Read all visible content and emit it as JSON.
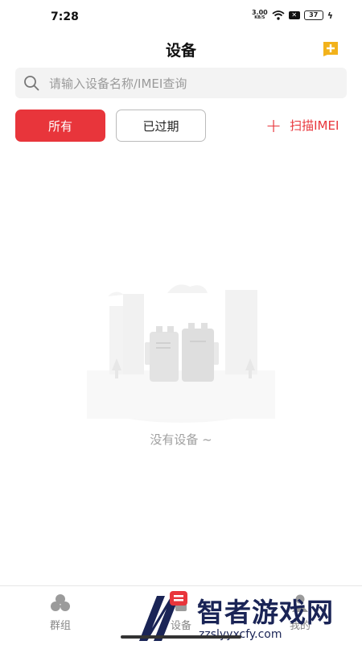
{
  "status_bar": {
    "time": "7:28",
    "speed_value": "3.00",
    "speed_unit": "KB/S",
    "battery": "37"
  },
  "header": {
    "title": "设备",
    "add_icon": "add-box-icon"
  },
  "search": {
    "placeholder": "请输入设备名称/IMEI查询",
    "value": ""
  },
  "filters": {
    "tabs": [
      {
        "label": "所有",
        "active": true
      },
      {
        "label": "已过期",
        "active": false
      }
    ],
    "scan_label": "扫描IMEI",
    "scan_icon": "plus-icon"
  },
  "empty_state": {
    "message": "没有设备 ~"
  },
  "bottom_nav": {
    "items": [
      {
        "label": "群组",
        "icon": "group-icon"
      },
      {
        "label": "设备",
        "icon": "device-icon"
      },
      {
        "label": "我的",
        "icon": "person-icon"
      }
    ]
  },
  "watermark": {
    "text": "智者游戏网",
    "url": "zzslyyxcfy.com"
  },
  "colors": {
    "accent": "#e8353b",
    "add_icon": "#f2b21b"
  }
}
